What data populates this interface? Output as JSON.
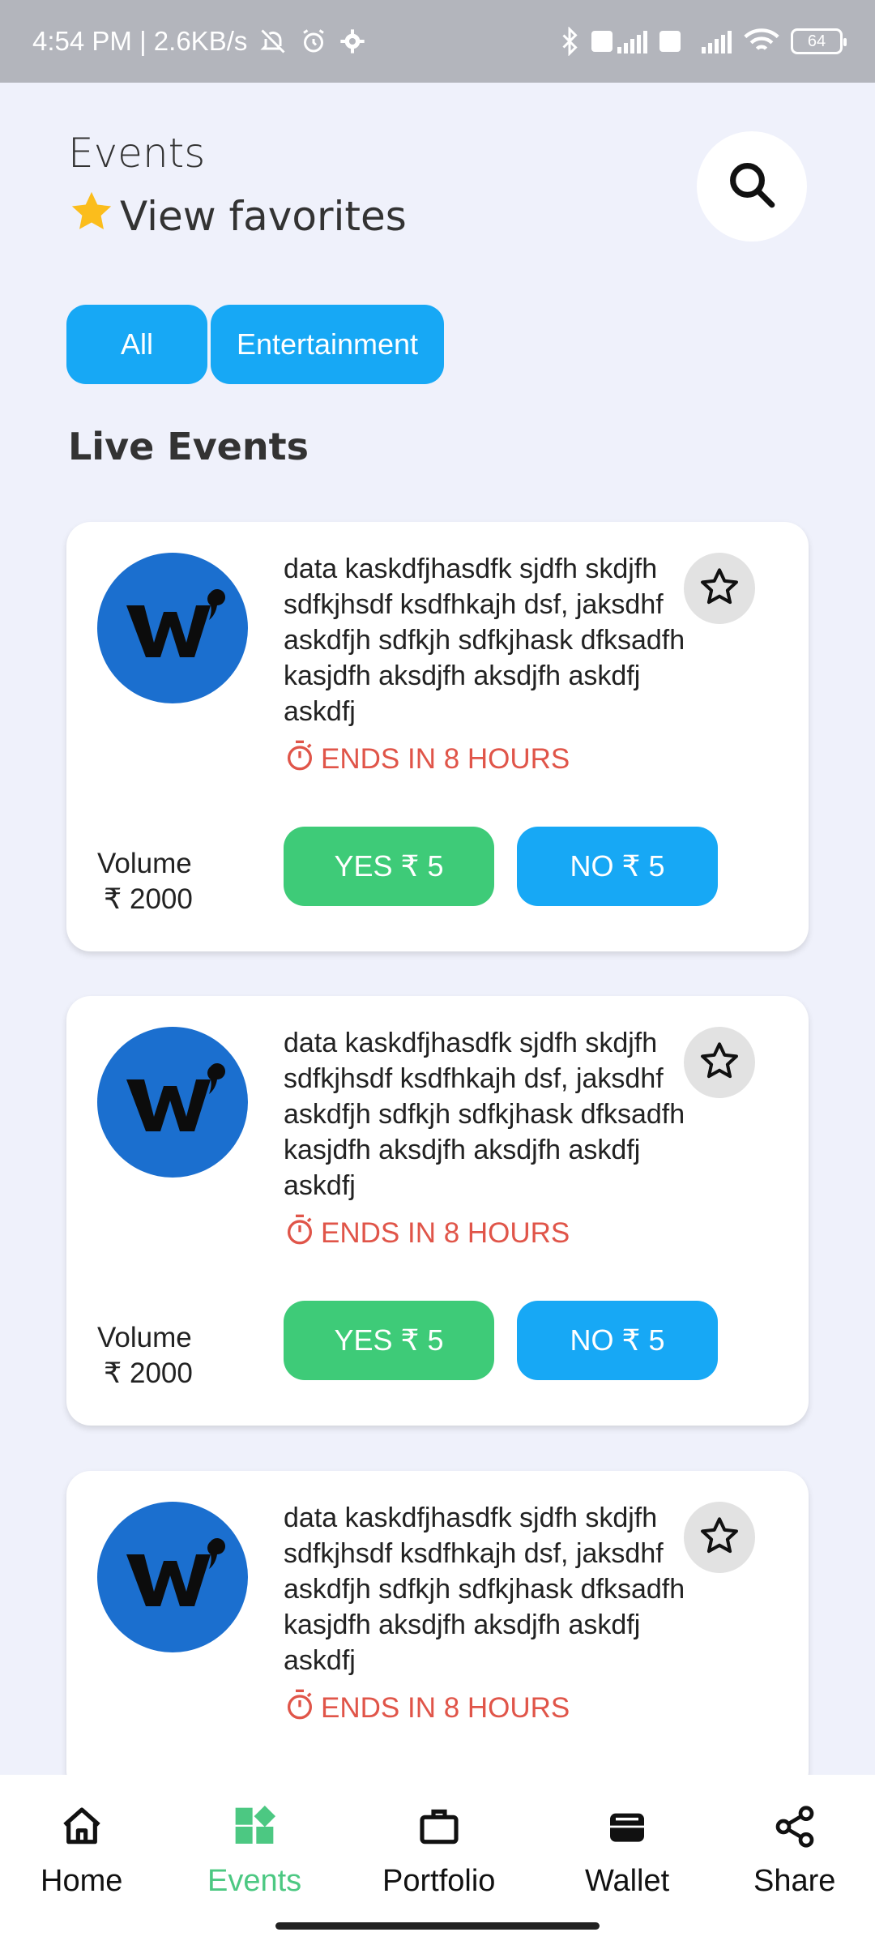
{
  "status_bar": {
    "time_speed": "4:54 PM | 2.6KB/s",
    "battery": "64"
  },
  "header": {
    "title": "Events",
    "favorites_label": "View favorites"
  },
  "filters": [
    {
      "label": "All"
    },
    {
      "label": "Entertainment"
    }
  ],
  "section_title": "Live Events",
  "events": [
    {
      "description": "data kaskdfjhasdfk sjdfh skdjfh sdfkjhsdf ksdfhkajh dsf, jaksdhf askdfjh sdfkjh sdfkjhask dfksadfh kasjdfh aksdjfh aksdjfh askdfj askdfj",
      "ends": "ENDS IN 8 HOURS",
      "volume_label": "Volume",
      "volume_amount": "₹ 2000",
      "yes_label": "YES ₹ 5",
      "no_label": "NO ₹ 5"
    },
    {
      "description": "data kaskdfjhasdfk sjdfh skdjfh sdfkjhsdf ksdfhkajh dsf, jaksdhf askdfjh sdfkjh sdfkjhask dfksadfh kasjdfh aksdjfh aksdjfh askdfj askdfj",
      "ends": "ENDS IN 8 HOURS",
      "volume_label": "Volume",
      "volume_amount": "₹ 2000",
      "yes_label": "YES ₹ 5",
      "no_label": "NO ₹ 5"
    },
    {
      "description": "data kaskdfjhasdfk sjdfh skdjfh sdfkjhsdf ksdfhkajh dsf, jaksdhf askdfjh sdfkjh sdfkjhask dfksadfh kasjdfh aksdjfh aksdjfh askdfj askdfj",
      "ends": "ENDS IN 8 HOURS"
    }
  ],
  "nav": [
    {
      "label": "Home",
      "icon": "home-icon"
    },
    {
      "label": "Events",
      "icon": "events-icon",
      "active": true
    },
    {
      "label": "Portfolio",
      "icon": "briefcase-icon"
    },
    {
      "label": "Wallet",
      "icon": "wallet-icon"
    },
    {
      "label": "Share",
      "icon": "share-icon"
    }
  ],
  "colors": {
    "accent_blue": "#17a8f5",
    "yes_green": "#3ecb78",
    "ends_red": "#e05549",
    "active_nav": "#4cc882",
    "logo_blue": "#1b6fcf"
  }
}
